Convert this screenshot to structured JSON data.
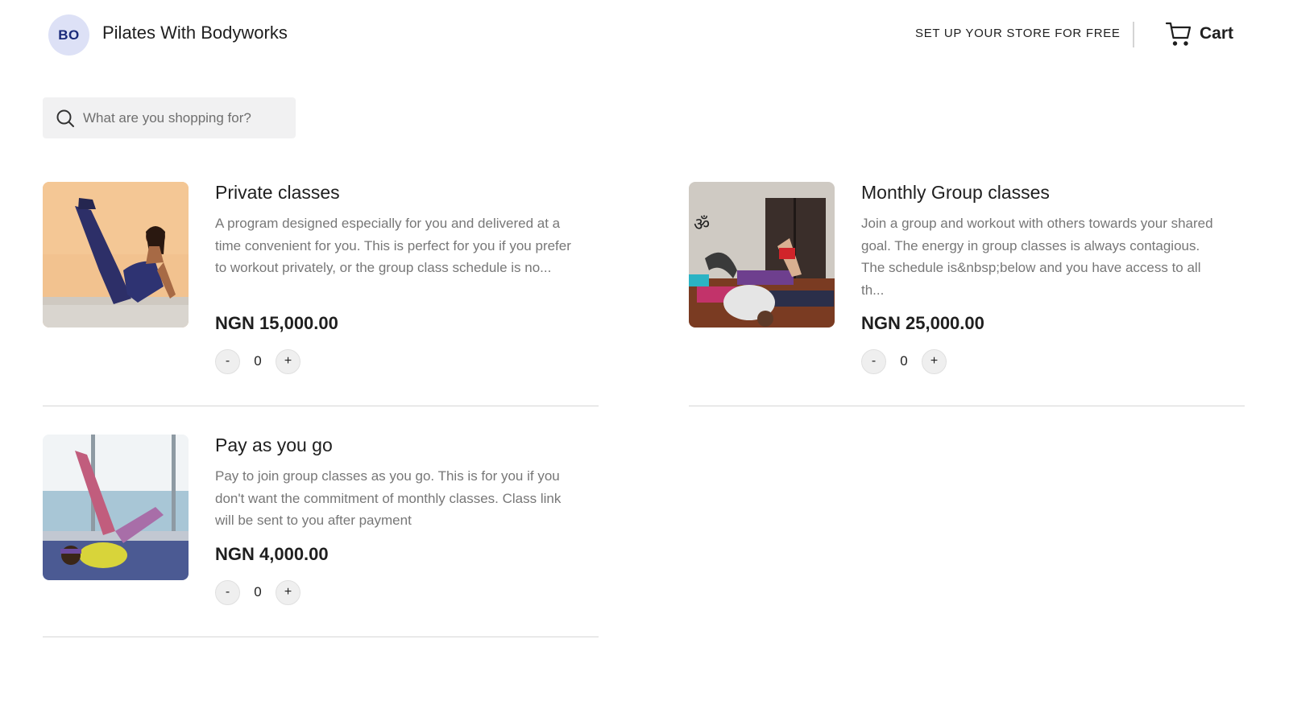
{
  "header": {
    "logo_initials": "BO",
    "store_name": "Pilates With Bodyworks",
    "setup_link": "SET UP YOUR STORE FOR FREE",
    "cart_label": "Cart"
  },
  "search": {
    "placeholder": "What are you shopping for?"
  },
  "products": [
    {
      "title": "Private classes",
      "description": "A program designed especially for you and delivered at a time convenient for you. This is perfect for you if you prefer to workout privately, or the group class schedule is no...",
      "price": "NGN 15,000.00",
      "qty_minus": "-",
      "quantity": "0",
      "qty_plus": "+"
    },
    {
      "title": "Monthly Group classes",
      "description": "Join a group and workout with others towards your shared goal. The energy in group classes is always contagious. The schedule is&nbsp;below and you have access to all th...",
      "price": "NGN 25,000.00",
      "qty_minus": "-",
      "quantity": "0",
      "qty_plus": "+"
    },
    {
      "title": "Pay as you go",
      "description": "Pay to join group classes as you go. This is for you if you don't want the commitment of monthly classes. Class link will be sent to you after payment",
      "price": "NGN 4,000.00",
      "qty_minus": "-",
      "quantity": "0",
      "qty_plus": "+"
    }
  ]
}
